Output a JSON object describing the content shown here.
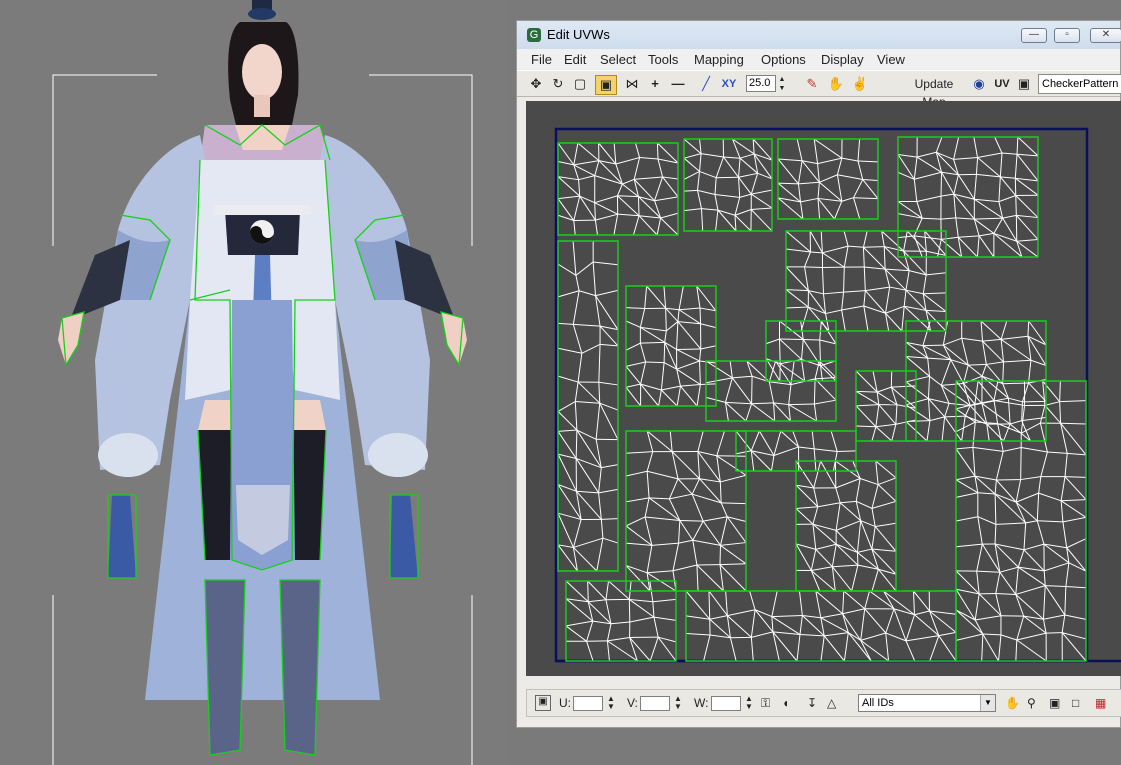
{
  "window": {
    "title": "Edit UVWs",
    "icon": "uvw-app-icon",
    "controls": [
      "minimize-icon",
      "maximize-icon",
      "close-icon"
    ]
  },
  "menu": [
    "File",
    "Edit",
    "Select",
    "Tools",
    "Mapping",
    "Options",
    "Display",
    "View"
  ],
  "toolbar": {
    "tools": [
      "move-icon",
      "rotate-icon",
      "scale-icon",
      "freeform-icon",
      "mirror-icon",
      "expand-icon",
      "contract-icon",
      "pencil-icon",
      "xy-icon"
    ],
    "xy_label": "XY",
    "spinner_value": "25.0",
    "update_map": "Update Map",
    "uv_label": "UV",
    "checker_pattern": "CheckerPattern"
  },
  "statusbar": {
    "u_label": "U:",
    "v_label": "V:",
    "w_label": "W:",
    "ids_value": "All IDs",
    "nav_icons": [
      "pan-icon",
      "zoom-icon",
      "zoom-region-icon",
      "zoom-extents-icon",
      "grid-icon"
    ]
  },
  "colors": {
    "seam": "#17d01b",
    "edge": "#ffffff",
    "canvas": "#4a4a4a",
    "border": "#0a0f5a"
  }
}
